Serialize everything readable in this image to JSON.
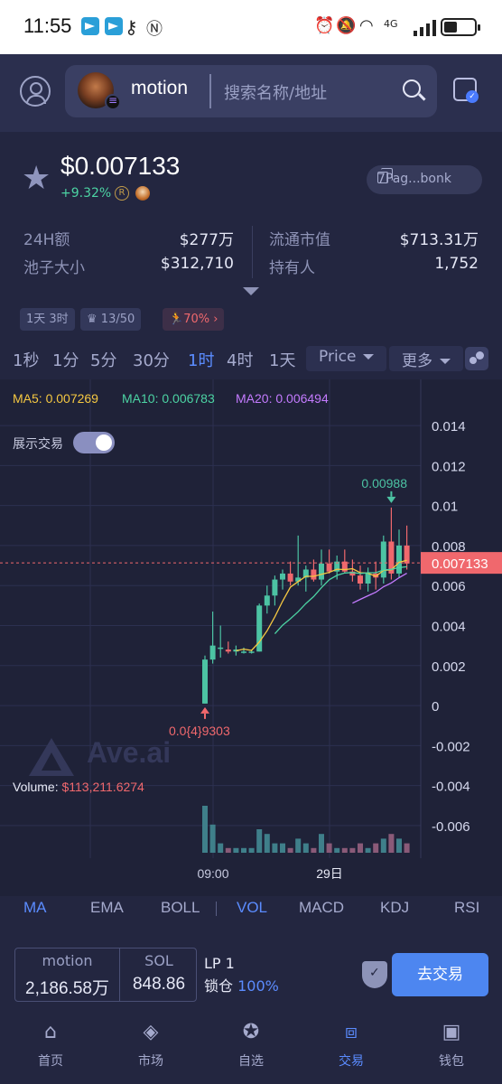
{
  "status_bar": {
    "time": "11:55",
    "left_icons": [
      "telegram-icon",
      "telegram-icon",
      "key-icon",
      "nfc-icon"
    ],
    "right_text": "4G"
  },
  "header": {
    "token_name": "motion",
    "search_placeholder": "搜索名称/地址"
  },
  "token": {
    "price": "$0.007133",
    "change": "+9.32%",
    "address_short": "7Pag...bonk",
    "stats": {
      "vol24h_label": "24H额",
      "vol24h_value": "$277万",
      "mcap_label": "流通市值",
      "mcap_value": "$713.31万",
      "pool_label": "池子大小",
      "pool_value": "$312,710",
      "holders_label": "持有人",
      "holders_value": "1,752"
    },
    "tags": {
      "age": "1天 3时",
      "rank": "13/50",
      "rate": "70%"
    }
  },
  "timeframes": [
    "1秒",
    "1分",
    "5分",
    "30分",
    "1时",
    "4时",
    "1天"
  ],
  "timeframe_active": "1时",
  "price_dropdown": "Price",
  "more_dropdown": "更多",
  "chart_data": {
    "type": "candlestick",
    "title": "",
    "ma_legend": {
      "ma5": "MA5: 0.007269",
      "ma10": "MA10: 0.006783",
      "ma20": "MA20: 0.006494"
    },
    "toggle_label": "展示交易",
    "y_ticks": [
      "0.014",
      "0.012",
      "0.01",
      "0.008",
      "0.006",
      "0.004",
      "0.002",
      "0",
      "-0.002",
      "-0.004",
      "-0.006"
    ],
    "ylim": [
      -0.0065,
      0.0145
    ],
    "current_price": "0.007133",
    "current_value": 0.007133,
    "high_label": "0.00988",
    "low_label": "0.0{4}9303",
    "volume_label": "Volume: ",
    "volume_value": "$113,211.6274",
    "x_labels": [
      "09:00",
      "29日"
    ],
    "watermark": "Ave.ai",
    "candles": [
      {
        "o": 0.0001,
        "h": 0.0025,
        "l": 0.0001,
        "c": 0.0023
      },
      {
        "o": 0.0023,
        "h": 0.0047,
        "l": 0.0021,
        "c": 0.003
      },
      {
        "o": 0.0029,
        "h": 0.004,
        "l": 0.0024,
        "c": 0.0029
      },
      {
        "o": 0.0028,
        "h": 0.0032,
        "l": 0.0026,
        "c": 0.0027
      },
      {
        "o": 0.0027,
        "h": 0.003,
        "l": 0.0025,
        "c": 0.0028
      },
      {
        "o": 0.0027,
        "h": 0.0029,
        "l": 0.0026,
        "c": 0.0027
      },
      {
        "o": 0.0027,
        "h": 0.0028,
        "l": 0.0026,
        "c": 0.0027
      },
      {
        "o": 0.0027,
        "h": 0.0051,
        "l": 0.0027,
        "c": 0.005
      },
      {
        "o": 0.005,
        "h": 0.006,
        "l": 0.0046,
        "c": 0.0055
      },
      {
        "o": 0.0055,
        "h": 0.0065,
        "l": 0.005,
        "c": 0.0063
      },
      {
        "o": 0.0063,
        "h": 0.0068,
        "l": 0.0058,
        "c": 0.0066
      },
      {
        "o": 0.0066,
        "h": 0.0072,
        "l": 0.006,
        "c": 0.0062
      },
      {
        "o": 0.0062,
        "h": 0.0085,
        "l": 0.006,
        "c": 0.0064
      },
      {
        "o": 0.0064,
        "h": 0.007,
        "l": 0.0057,
        "c": 0.0068
      },
      {
        "o": 0.0068,
        "h": 0.0073,
        "l": 0.0062,
        "c": 0.0063
      },
      {
        "o": 0.0063,
        "h": 0.0078,
        "l": 0.006,
        "c": 0.0071
      },
      {
        "o": 0.0071,
        "h": 0.0078,
        "l": 0.0066,
        "c": 0.0067
      },
      {
        "o": 0.0067,
        "h": 0.0075,
        "l": 0.0063,
        "c": 0.0072
      },
      {
        "o": 0.0072,
        "h": 0.0078,
        "l": 0.0066,
        "c": 0.0067
      },
      {
        "o": 0.0067,
        "h": 0.0073,
        "l": 0.0062,
        "c": 0.0065
      },
      {
        "o": 0.0065,
        "h": 0.007,
        "l": 0.0058,
        "c": 0.0061
      },
      {
        "o": 0.0061,
        "h": 0.0069,
        "l": 0.0057,
        "c": 0.0066
      },
      {
        "o": 0.0066,
        "h": 0.0072,
        "l": 0.0058,
        "c": 0.0064
      },
      {
        "o": 0.0064,
        "h": 0.0085,
        "l": 0.0061,
        "c": 0.0082
      },
      {
        "o": 0.0082,
        "h": 0.0099,
        "l": 0.0063,
        "c": 0.0066
      },
      {
        "o": 0.0066,
        "h": 0.0088,
        "l": 0.0064,
        "c": 0.008
      },
      {
        "o": 0.008,
        "h": 0.009,
        "l": 0.0068,
        "c": 0.0071
      }
    ],
    "volumes": [
      10,
      6,
      2,
      1,
      1,
      1,
      1,
      5,
      4,
      2,
      2,
      1,
      3,
      2,
      1,
      4,
      2,
      1,
      1,
      1,
      2,
      1,
      2,
      3,
      4,
      3,
      2
    ]
  },
  "indicators": [
    "MA",
    "EMA",
    "BOLL",
    "VOL",
    "MACD",
    "KDJ",
    "RSI"
  ],
  "indicators_active": [
    "MA",
    "VOL"
  ],
  "trade": {
    "pair_token": "motion",
    "pair_token_amount": "2,186.58万",
    "pair_base": "SOL",
    "pair_base_amount": "848.86",
    "lp_label": "LP 1",
    "lock_label": "锁仓 ",
    "lock_pct": "100%",
    "trade_button": "去交易"
  },
  "bottom_nav": [
    {
      "label": "首页",
      "icon": "home-icon"
    },
    {
      "label": "市场",
      "icon": "layers-icon"
    },
    {
      "label": "自选",
      "icon": "star-icon"
    },
    {
      "label": "交易",
      "icon": "trade-icon"
    },
    {
      "label": "钱包",
      "icon": "wallet-icon"
    }
  ],
  "colors": {
    "up": "#4cc3a3",
    "down": "#f0686d",
    "accent": "#5b8cff",
    "ma5": "#f5c842",
    "ma10": "#4cd3a3",
    "ma20": "#c47bff"
  }
}
